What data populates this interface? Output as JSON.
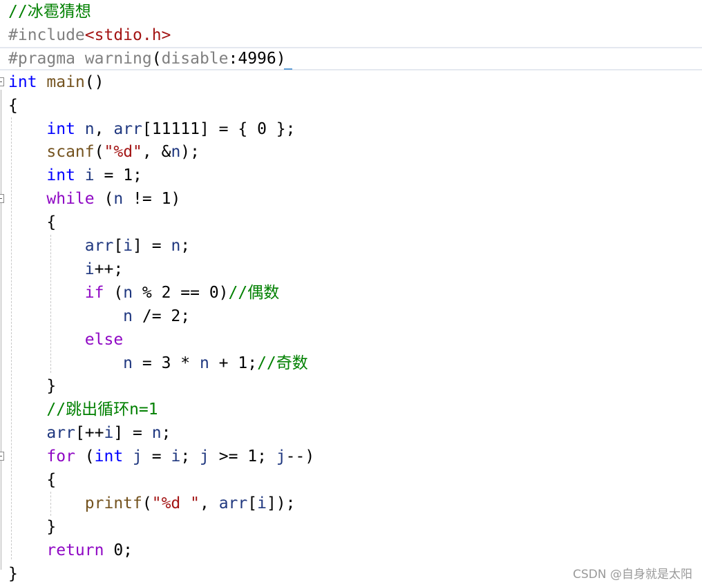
{
  "editor": {
    "lines": [
      [
        {
          "t": "//冰雹猜想",
          "c": "cm"
        }
      ],
      [
        {
          "t": "#include",
          "c": "pp"
        },
        {
          "t": "<stdio.h>",
          "c": "inc"
        }
      ],
      [
        {
          "t": "#pragma warning",
          "c": "pp"
        },
        {
          "t": "(",
          "c": "txt"
        },
        {
          "t": "disable",
          "c": "pp"
        },
        {
          "t": ":4996)",
          "c": "txt"
        }
      ],
      [
        {
          "t": "int",
          "c": "kw"
        },
        {
          "t": " ",
          "c": "txt"
        },
        {
          "t": "main",
          "c": "fn"
        },
        {
          "t": "()",
          "c": "txt"
        }
      ],
      [
        {
          "t": "{",
          "c": "txt"
        }
      ],
      [
        {
          "t": "    ",
          "c": "txt"
        },
        {
          "t": "int",
          "c": "kw"
        },
        {
          "t": " ",
          "c": "txt"
        },
        {
          "t": "n",
          "c": "var"
        },
        {
          "t": ", ",
          "c": "txt"
        },
        {
          "t": "arr",
          "c": "var"
        },
        {
          "t": "[11111] = { 0 };",
          "c": "txt"
        }
      ],
      [
        {
          "t": "    ",
          "c": "txt"
        },
        {
          "t": "scanf",
          "c": "fn"
        },
        {
          "t": "(",
          "c": "txt"
        },
        {
          "t": "\"%d\"",
          "c": "str"
        },
        {
          "t": ", &",
          "c": "txt"
        },
        {
          "t": "n",
          "c": "var"
        },
        {
          "t": ");",
          "c": "txt"
        }
      ],
      [
        {
          "t": "    ",
          "c": "txt"
        },
        {
          "t": "int",
          "c": "kw"
        },
        {
          "t": " ",
          "c": "txt"
        },
        {
          "t": "i",
          "c": "var"
        },
        {
          "t": " = 1;",
          "c": "txt"
        }
      ],
      [
        {
          "t": "    ",
          "c": "txt"
        },
        {
          "t": "while",
          "c": "ctl"
        },
        {
          "t": " (",
          "c": "txt"
        },
        {
          "t": "n",
          "c": "var"
        },
        {
          "t": " != 1)",
          "c": "txt"
        }
      ],
      [
        {
          "t": "    {",
          "c": "txt"
        }
      ],
      [
        {
          "t": "        ",
          "c": "txt"
        },
        {
          "t": "arr",
          "c": "var"
        },
        {
          "t": "[",
          "c": "txt"
        },
        {
          "t": "i",
          "c": "var"
        },
        {
          "t": "] = ",
          "c": "txt"
        },
        {
          "t": "n",
          "c": "var"
        },
        {
          "t": ";",
          "c": "txt"
        }
      ],
      [
        {
          "t": "        ",
          "c": "txt"
        },
        {
          "t": "i",
          "c": "var"
        },
        {
          "t": "++;",
          "c": "txt"
        }
      ],
      [
        {
          "t": "        ",
          "c": "txt"
        },
        {
          "t": "if",
          "c": "ctl"
        },
        {
          "t": " (",
          "c": "txt"
        },
        {
          "t": "n",
          "c": "var"
        },
        {
          "t": " % 2 == 0)",
          "c": "txt"
        },
        {
          "t": "//偶数",
          "c": "cm"
        }
      ],
      [
        {
          "t": "            ",
          "c": "txt"
        },
        {
          "t": "n",
          "c": "var"
        },
        {
          "t": " /= 2;",
          "c": "txt"
        }
      ],
      [
        {
          "t": "        ",
          "c": "txt"
        },
        {
          "t": "else",
          "c": "ctl"
        }
      ],
      [
        {
          "t": "            ",
          "c": "txt"
        },
        {
          "t": "n",
          "c": "var"
        },
        {
          "t": " = 3 * ",
          "c": "txt"
        },
        {
          "t": "n",
          "c": "var"
        },
        {
          "t": " + 1;",
          "c": "txt"
        },
        {
          "t": "//奇数",
          "c": "cm"
        }
      ],
      [
        {
          "t": "    }",
          "c": "txt"
        }
      ],
      [
        {
          "t": "    ",
          "c": "txt"
        },
        {
          "t": "//跳出循环n=1",
          "c": "cm"
        }
      ],
      [
        {
          "t": "    ",
          "c": "txt"
        },
        {
          "t": "arr",
          "c": "var"
        },
        {
          "t": "[++",
          "c": "txt"
        },
        {
          "t": "i",
          "c": "var"
        },
        {
          "t": "] = ",
          "c": "txt"
        },
        {
          "t": "n",
          "c": "var"
        },
        {
          "t": ";",
          "c": "txt"
        }
      ],
      [
        {
          "t": "    ",
          "c": "txt"
        },
        {
          "t": "for",
          "c": "ctl"
        },
        {
          "t": " (",
          "c": "txt"
        },
        {
          "t": "int",
          "c": "kw"
        },
        {
          "t": " ",
          "c": "txt"
        },
        {
          "t": "j",
          "c": "var"
        },
        {
          "t": " = ",
          "c": "txt"
        },
        {
          "t": "i",
          "c": "var"
        },
        {
          "t": "; ",
          "c": "txt"
        },
        {
          "t": "j",
          "c": "var"
        },
        {
          "t": " >= 1; ",
          "c": "txt"
        },
        {
          "t": "j",
          "c": "var"
        },
        {
          "t": "--)",
          "c": "txt"
        }
      ],
      [
        {
          "t": "    {",
          "c": "txt"
        }
      ],
      [
        {
          "t": "        ",
          "c": "txt"
        },
        {
          "t": "printf",
          "c": "fn"
        },
        {
          "t": "(",
          "c": "txt"
        },
        {
          "t": "\"%d \"",
          "c": "str"
        },
        {
          "t": ", ",
          "c": "txt"
        },
        {
          "t": "arr",
          "c": "var"
        },
        {
          "t": "[",
          "c": "txt"
        },
        {
          "t": "i",
          "c": "var"
        },
        {
          "t": "]);",
          "c": "txt"
        }
      ],
      [
        {
          "t": "    }",
          "c": "txt"
        }
      ],
      [
        {
          "t": "    ",
          "c": "txt"
        },
        {
          "t": "return",
          "c": "ctl"
        },
        {
          "t": " 0;",
          "c": "txt"
        }
      ],
      [
        {
          "t": "}",
          "c": "txt"
        }
      ]
    ],
    "current_line": 2,
    "fold_lines": [
      3,
      8,
      19
    ]
  },
  "watermark": "CSDN @自身就是太阳"
}
